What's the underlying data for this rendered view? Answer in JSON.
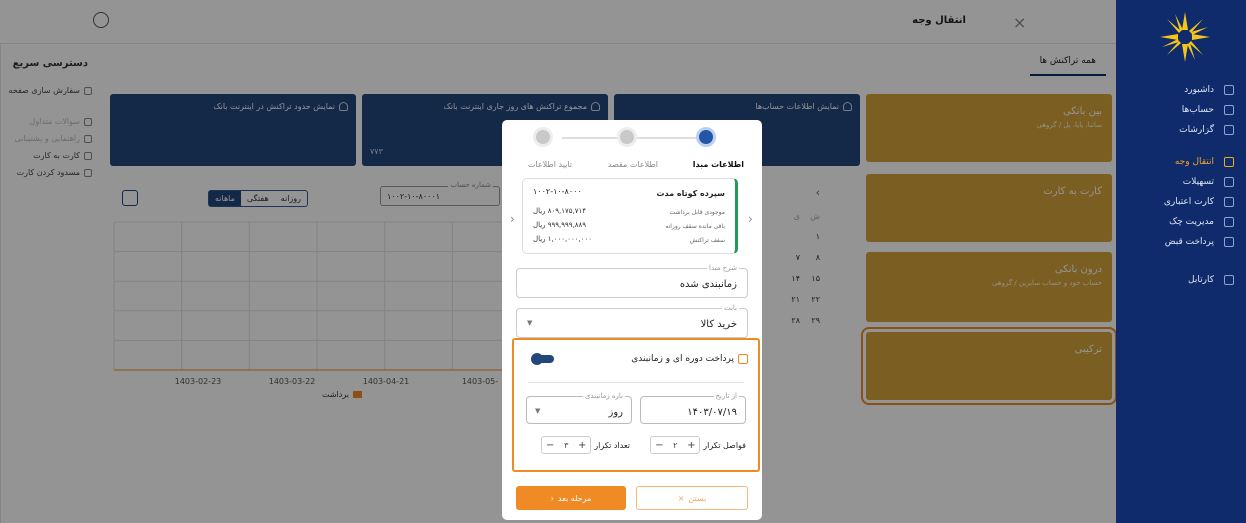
{
  "window": {
    "title": "انتقال وجه",
    "close_icon": "×"
  },
  "sidebar": {
    "items": [
      {
        "label": "داشبورد",
        "icon": "dashboard-icon"
      },
      {
        "label": "حساب‌ها",
        "icon": "wallet-icon"
      },
      {
        "label": "گزارشات",
        "icon": "report-icon"
      },
      {
        "label": "انتقال وجه",
        "icon": "transfer-icon",
        "active": true
      },
      {
        "label": "تسهیلات",
        "icon": "loan-icon"
      },
      {
        "label": "کارت اعتباری",
        "icon": "credit-card-icon"
      },
      {
        "label": "مدیریت چک",
        "icon": "check-icon"
      },
      {
        "label": "پرداخت قبض",
        "icon": "bill-icon"
      },
      {
        "label": "کارتابل",
        "icon": "inbox-icon"
      }
    ]
  },
  "quick_access": {
    "title": "دسترسی سریع",
    "items": [
      {
        "label": "سفارش سازی صفحه",
        "dim": false
      },
      {
        "label": "سوالات متداول",
        "dim": true
      },
      {
        "label": "راهنمایی و پشتیبانی",
        "dim": true
      },
      {
        "label": "کارت به کارت",
        "dim": false
      },
      {
        "label": "مسدود کردن کارت",
        "dim": false
      }
    ]
  },
  "main": {
    "tab": "همه تراکنش ها",
    "blue_cards": [
      {
        "caption": "نمایش حدود تراکنش در اینترنت بانک",
        "value": ""
      },
      {
        "caption": "مجموع تراکنش های روز جاری اینترنت بانک",
        "value": "۷۷۳"
      },
      {
        "caption": "نمایش اطلاعات حساب‌ها",
        "value": ""
      }
    ],
    "gold_cards": [
      {
        "title": "بین بانکی",
        "subtitle": "ساتنا، پایا، پل / گروهی"
      },
      {
        "title": "کارت به کارت",
        "subtitle": ""
      },
      {
        "title": "درون بانکی",
        "subtitle": "حساب خود و حساب سایرین / گروهی"
      },
      {
        "title": "ترکیبی",
        "subtitle": "",
        "selected": true
      }
    ],
    "chart_controls": {
      "segments": [
        "روزانه",
        "هفتگی",
        "ماهانه"
      ],
      "active_segment": "ماهانه",
      "account_label": "شماره حساب",
      "account_value": "۱۰۰۲-۱۰-۸۰۰۰۱"
    },
    "calendar": {
      "nav": "›",
      "weekdays": [
        "ش",
        "ی"
      ],
      "rows": [
        [
          "۱",
          ""
        ],
        [
          "۸",
          "۷"
        ],
        [
          "۱۵",
          "۱۴"
        ],
        [
          "۲۲",
          "۲۱"
        ],
        [
          "۲۹",
          "۲۸"
        ]
      ]
    }
  },
  "chart_data": {
    "type": "bar",
    "categories": [
      "1403-02-23",
      "1403-03-22",
      "1403-04-21",
      "1403-05-"
    ],
    "series": [
      {
        "name": "برداشت",
        "values": [
          0,
          0,
          0,
          0
        ],
        "color": "#f08a24"
      }
    ],
    "grid": true,
    "legend": "bottom"
  },
  "modal": {
    "steps": [
      {
        "label": "اطلاعات مبدا",
        "active": true
      },
      {
        "label": "اطلاعات مقصد",
        "active": false
      },
      {
        "label": "تایید اطلاعات",
        "active": false
      }
    ],
    "source_card": {
      "title": "سپرده کوتاه مدت",
      "account": "۱۰۰۲-۱۰-۸۰۰۰",
      "rows": [
        {
          "label": "موجودی قابل برداشت",
          "value": "۸۰۹,۱۷۵,۷۱۴ ریال"
        },
        {
          "label": "باقی مانده سقف روزانه",
          "value": "۹۹۹,۹۹۹,۸۸۹ ریال"
        },
        {
          "label": "سقف تراکنش",
          "value": "۱,۰۰۰,۰۰۰,۰۰۰ ریال"
        }
      ]
    },
    "source_description": {
      "label": "شرح مبدا",
      "value": "زمانبندی شده"
    },
    "reason": {
      "label": "بابت",
      "value": "خرید کالا"
    },
    "periodic": {
      "title": "پرداخت دوره ای و زمانبندی",
      "toggle_on": true,
      "from_date": {
        "label": "از تاریخ",
        "value": "۱۴۰۳/۰۷/۱۹"
      },
      "period": {
        "label": "بازه زمانبندی",
        "value": "روز"
      },
      "interval": {
        "label": "فواصل تکرار",
        "value": "۲"
      },
      "count": {
        "label": "تعداد تکرار",
        "value": "۳"
      }
    },
    "buttons": {
      "next": "مرحله بعد",
      "close": "بستن"
    }
  }
}
